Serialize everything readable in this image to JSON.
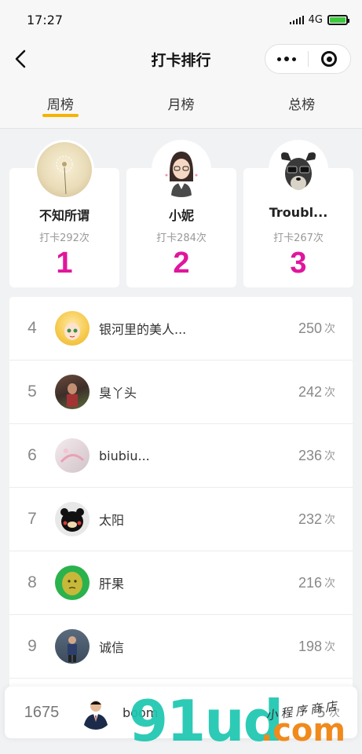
{
  "status_bar": {
    "time": "17:27",
    "network": "4G"
  },
  "nav": {
    "title": "打卡排行"
  },
  "tabs": [
    {
      "label": "周榜",
      "active": true
    },
    {
      "label": "月榜",
      "active": false
    },
    {
      "label": "总榜",
      "active": false
    }
  ],
  "podium": [
    {
      "rank": "1",
      "name": "不知所谓",
      "count_text": "打卡292次"
    },
    {
      "rank": "2",
      "name": "小妮",
      "count_text": "打卡284次"
    },
    {
      "rank": "3",
      "name": "Troubl...",
      "count_text": "打卡267次"
    }
  ],
  "list": [
    {
      "rank": "4",
      "name": "银河里的美人...",
      "count": "250",
      "unit": "次"
    },
    {
      "rank": "5",
      "name": "臭丫头",
      "count": "242",
      "unit": "次"
    },
    {
      "rank": "6",
      "name": "biubiu...",
      "count": "236",
      "unit": "次"
    },
    {
      "rank": "7",
      "name": "太阳",
      "count": "232",
      "unit": "次"
    },
    {
      "rank": "8",
      "name": "肝果",
      "count": "216",
      "unit": "次"
    },
    {
      "rank": "9",
      "name": "诚信",
      "count": "198",
      "unit": "次"
    }
  ],
  "me": {
    "rank": "1675",
    "name": "boom",
    "count": "5",
    "unit": "次"
  },
  "watermark": {
    "main": "91ud",
    "suffix": ".com",
    "sub": "小程序商店"
  },
  "colors": {
    "rank_accent": "#e0169c",
    "tab_underline": "#f4b400",
    "watermark_teal": "#1cc7b0",
    "watermark_orange": "#f08a1c"
  }
}
